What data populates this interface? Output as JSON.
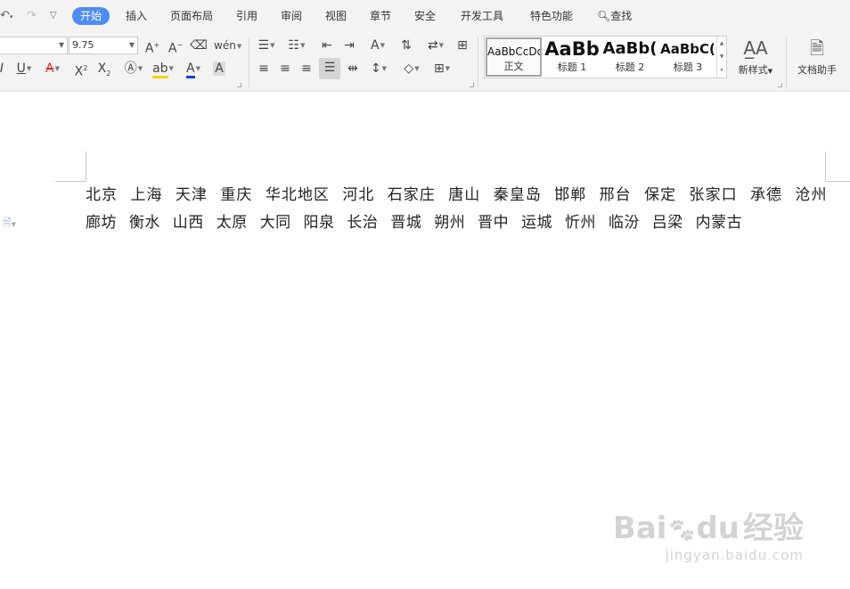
{
  "menu": {
    "tabs": [
      "开始",
      "插入",
      "页面布局",
      "引用",
      "审阅",
      "视图",
      "章节",
      "安全",
      "开发工具",
      "特色功能"
    ],
    "active": "开始",
    "search_label": "查找"
  },
  "font": {
    "name_value": "",
    "size_value": "9.75"
  },
  "styles": [
    {
      "preview": "AaBbCcDd",
      "label": "正文"
    },
    {
      "preview": "AaBb",
      "label": "标题 1"
    },
    {
      "preview": "AaBb(",
      "label": "标题 2"
    },
    {
      "preview": "AaBbC(",
      "label": "标题 3"
    }
  ],
  "new_style_label": "新样式",
  "doc_assistant_label": "文档助手",
  "document": {
    "text": "北京 上海 天津 重庆 华北地区 河北 石家庄 唐山 秦皇岛 邯郸 邢台 保定 张家口 承德 沧州 廊坊 衡水 山西 太原 大同 阳泉 长治 晋城 朔州 晋中 运城 忻州 临汾 吕梁 内蒙古"
  },
  "watermark": {
    "brand": "Bai",
    "brand_du": "du",
    "brand_cn": "经验",
    "url": "jingyan.baidu.com"
  },
  "colors": {
    "accent": "#4e8cf5",
    "highlight": "#f7d200",
    "font_color": "#1a3fd6",
    "doc_text": "#222222"
  }
}
